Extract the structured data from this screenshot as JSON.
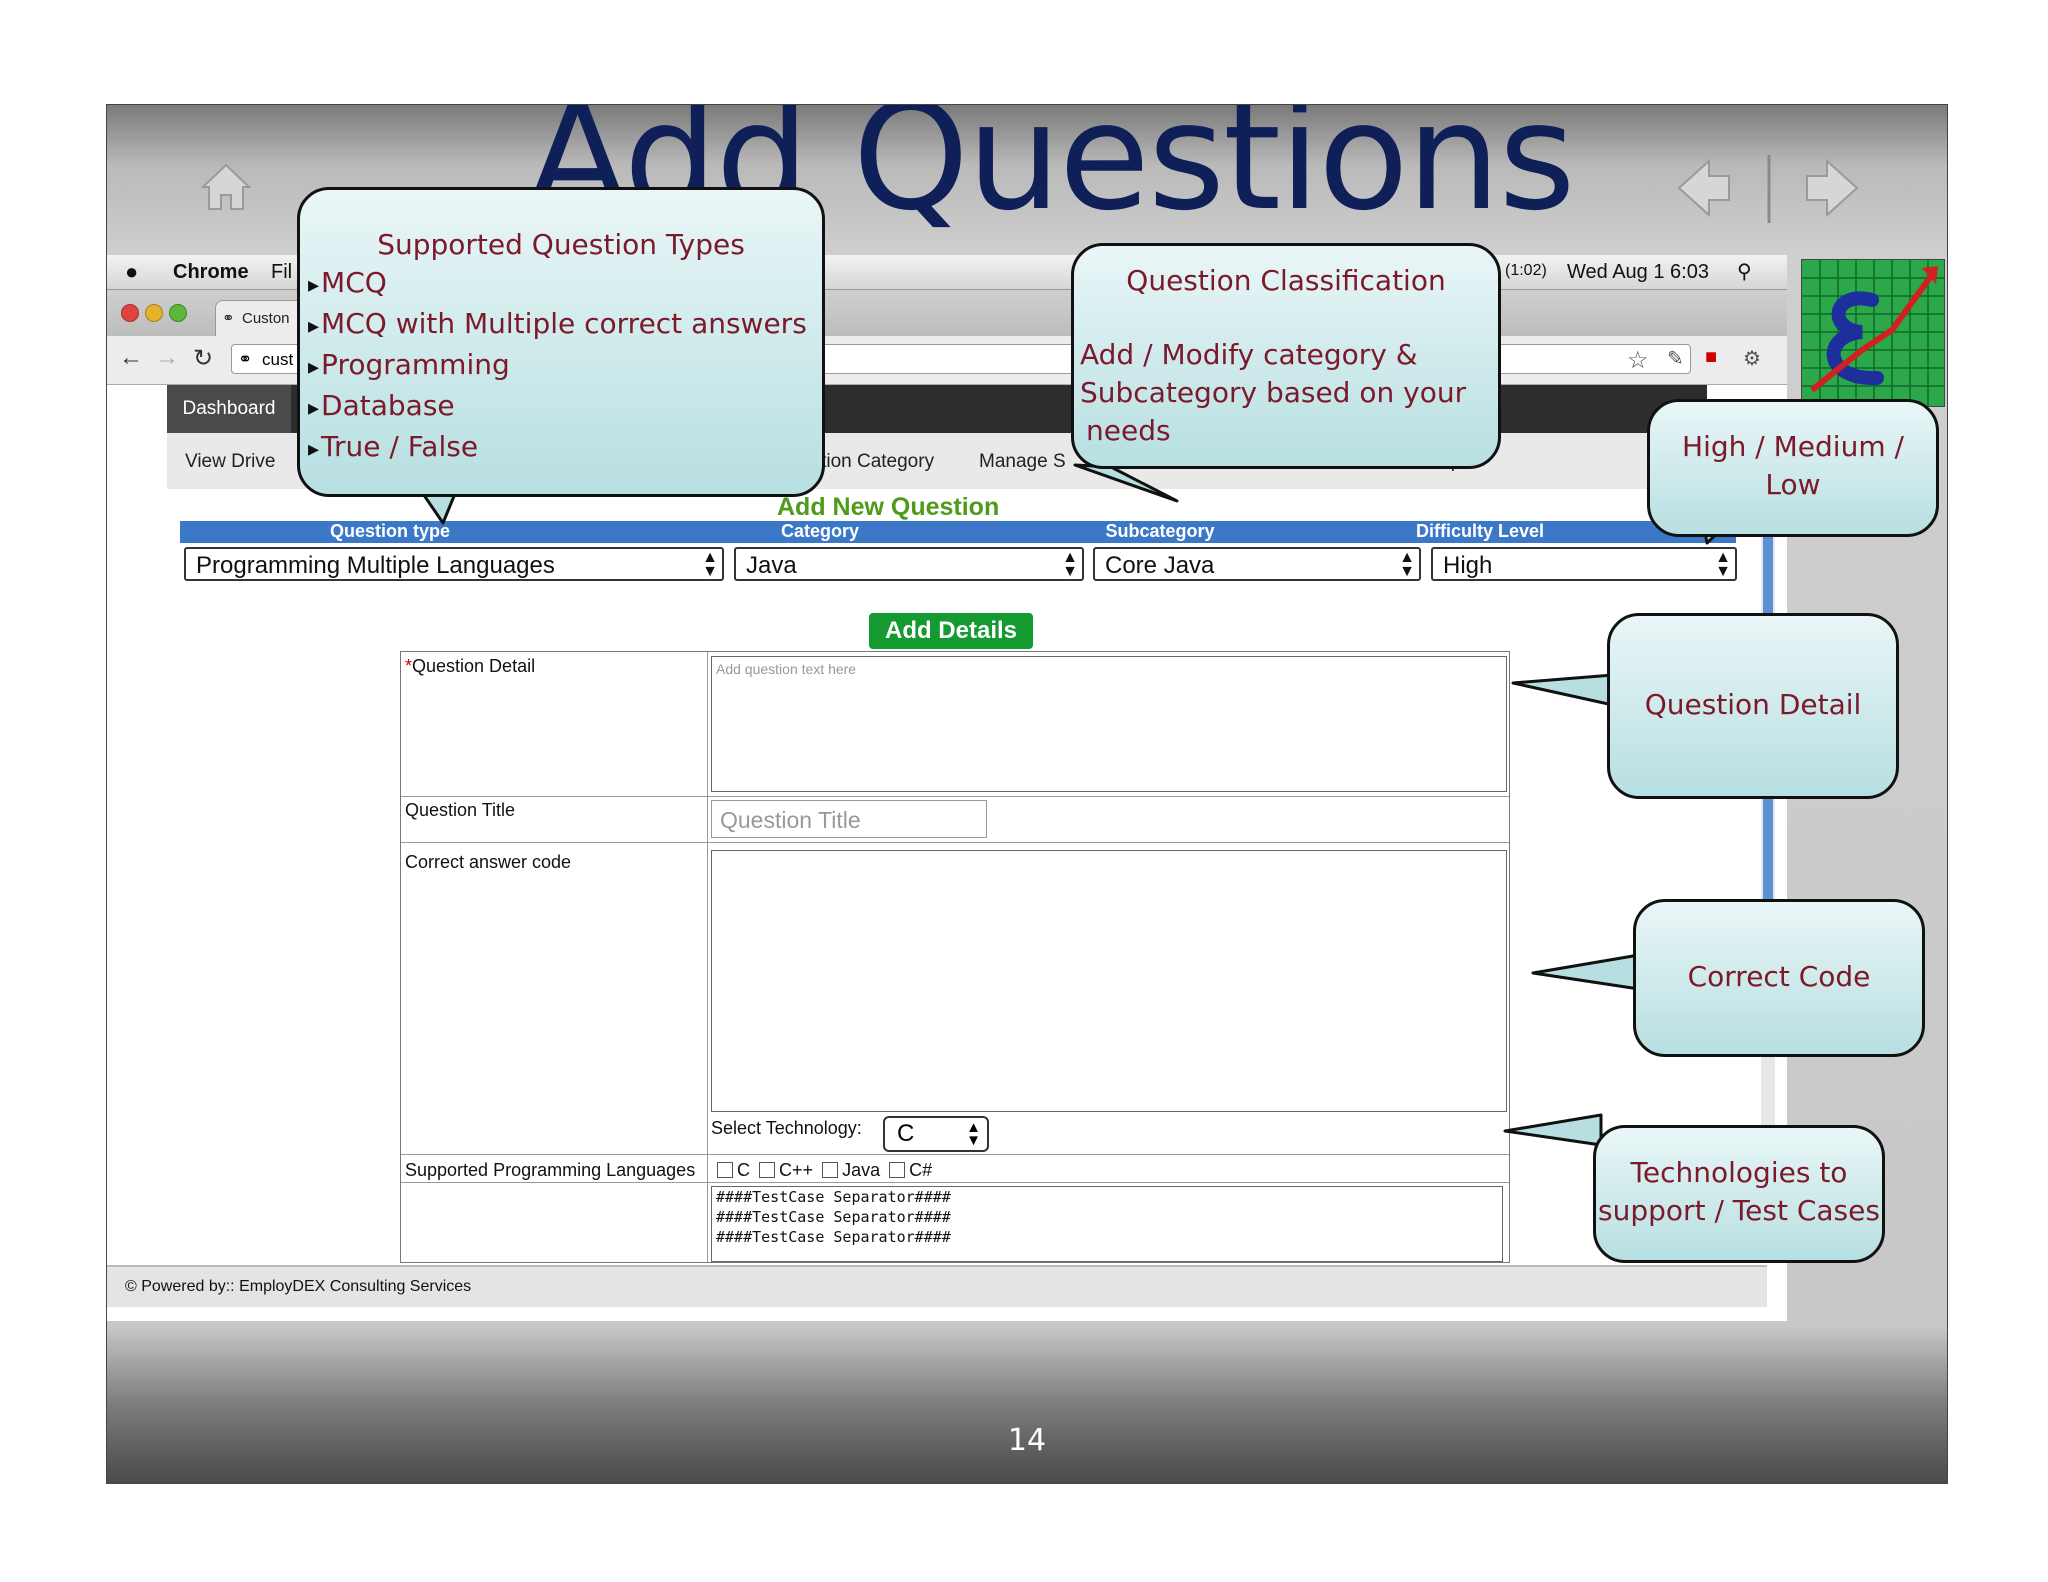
{
  "slide": {
    "title": "Add Questions",
    "page_number": "14"
  },
  "mac_menu": {
    "app": "Chrome",
    "file_menu": "Fil",
    "battery": "(1:02)",
    "clock": "Wed Aug 1  6:03"
  },
  "browser": {
    "tab_label": "Custon",
    "address": "cust"
  },
  "app_nav": {
    "dashboard": "Dashboard",
    "menu_items": [
      "View Drive",
      "estion Category",
      "Manage S",
      "t Paper"
    ]
  },
  "form": {
    "heading": "Add New Question",
    "columns": [
      "Question type",
      "Category",
      "Subcategory",
      "Difficulty Level"
    ],
    "selects": {
      "question_type": "Programming Multiple Languages",
      "category": "Java",
      "subcategory": "Core Java",
      "difficulty": "High"
    },
    "add_details_label": "Add Details",
    "question_detail_label": "Question Detail",
    "question_detail_required": "*",
    "question_detail_placeholder": "Add question text here",
    "question_title_label": "Question Title",
    "question_title_placeholder": "Question Title",
    "correct_code_label": "Correct answer code",
    "select_technology_label": "Select Technology:",
    "technology_value": "C",
    "supported_langs_label": "Supported Programming Languages",
    "languages": [
      "C",
      "C++",
      "Java",
      "C#"
    ],
    "testcase_lines": [
      "####TestCase Separator####",
      "####TestCase Separator####",
      "####TestCase Separator####"
    ]
  },
  "footer": {
    "powered_by": "© Powered by:: EmployDEX Consulting Services"
  },
  "callouts": {
    "question_types": {
      "title": "Supported Question Types",
      "items": [
        "MCQ",
        "MCQ with Multiple correct answers",
        "Programming",
        "Database",
        "True / False"
      ]
    },
    "classification": {
      "title": "Question Classification",
      "lines": [
        "Add / Modify category &",
        "Subcategory based on your",
        "needs"
      ]
    },
    "difficulty": {
      "lines": [
        "High / Medium /",
        "Low"
      ]
    },
    "question_detail": {
      "text": "Question Detail"
    },
    "correct_code": {
      "text": "Correct Code"
    },
    "technologies": {
      "lines": [
        "Technologies to",
        "support / Test Cases"
      ]
    }
  },
  "colors": {
    "title": "#0f1f57",
    "callout_text": "#7a1a2b",
    "header_bar": "#3c78c8",
    "add_button": "#149a31",
    "form_heading": "#4f9a1a"
  }
}
